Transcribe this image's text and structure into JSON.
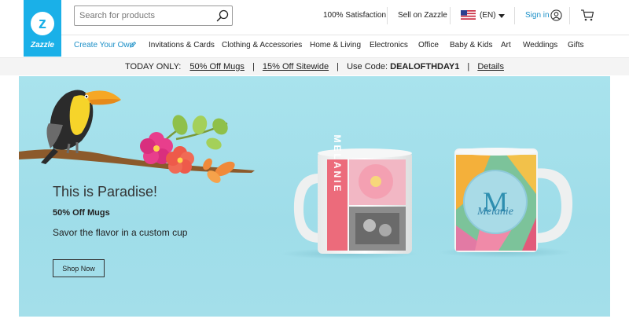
{
  "brand": {
    "logo_text": "Zazzle",
    "logo_mark": "z"
  },
  "search": {
    "placeholder": "Search for products"
  },
  "top_nav": {
    "satisfaction": "100% Satisfaction",
    "sell": "Sell on Zazzle",
    "language": "(EN)",
    "sign_in": "Sign in"
  },
  "categories": [
    "Create Your Own",
    "Invitations & Cards",
    "Clothing & Accessories",
    "Home & Living",
    "Electronics",
    "Office",
    "Baby & Kids",
    "Art",
    "Weddings",
    "Gifts"
  ],
  "promo": {
    "today_only": "TODAY ONLY:",
    "offer_mugs": "50% Off Mugs",
    "offer_sitewide": "15% Off Sitewide",
    "use_code_label": "Use Code:",
    "code": "DEALOFTHDAY1",
    "details": "Details",
    "separator": "|"
  },
  "hero": {
    "title": "This is Paradise!",
    "subtitle": "50% Off Mugs",
    "description": "Savor the flavor in a custom cup",
    "button": "Shop Now",
    "mug1_name": "MELANIE",
    "mug2_monogram": "M",
    "mug2_script": "Melanie"
  },
  "icons": {
    "search": "search-icon",
    "flag": "us-flag-icon",
    "dropdown": "chevron-down-icon",
    "user": "user-icon",
    "cart": "cart-icon",
    "create": "pencil-icon"
  },
  "colors": {
    "brand": "#1ab0e8",
    "link": "#1a8fc7",
    "hero_bg": "#a9e3ed",
    "mug_stripe": "#ec6b7b"
  }
}
